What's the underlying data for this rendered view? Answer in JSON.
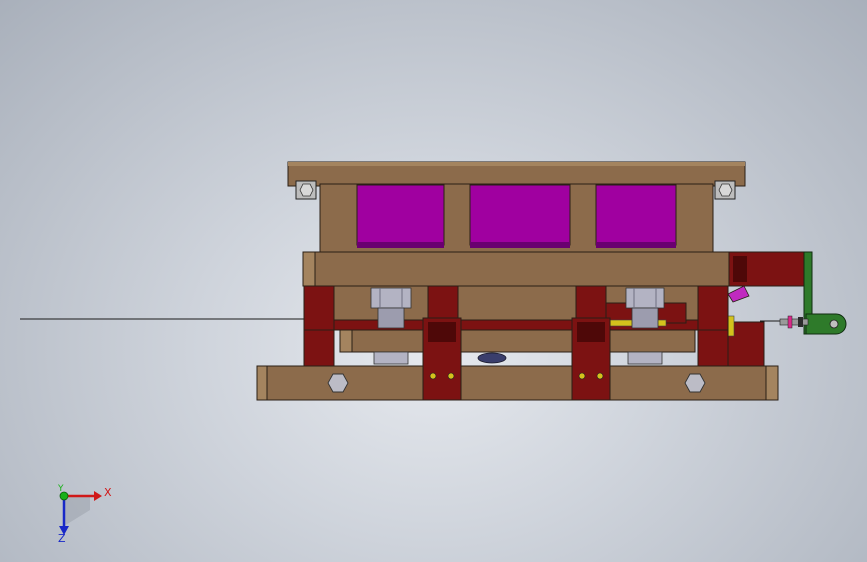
{
  "viewport": {
    "background": "#c3c9d2"
  },
  "model": {
    "colors": {
      "plate": "#8c6b4b",
      "plate_edge": "#2a1f16",
      "plate_highlight": "#a4845f",
      "cavity": "#a000a0",
      "cavity_shadow": "#6a0070",
      "post": "#7c1212",
      "post_dark": "#4e0808",
      "bushing": "#b3b3c3",
      "bushing_dark": "#6f6f80",
      "bracket_green": "#2e7a2a",
      "pin_yellow": "#d4c21c",
      "magenta_part": "#c02ac0"
    }
  },
  "triad": {
    "x_label": "X",
    "y_label": "Y",
    "z_label": "Z",
    "x_color": "#d01818",
    "y_color": "#18b018",
    "z_color": "#1828c8"
  }
}
